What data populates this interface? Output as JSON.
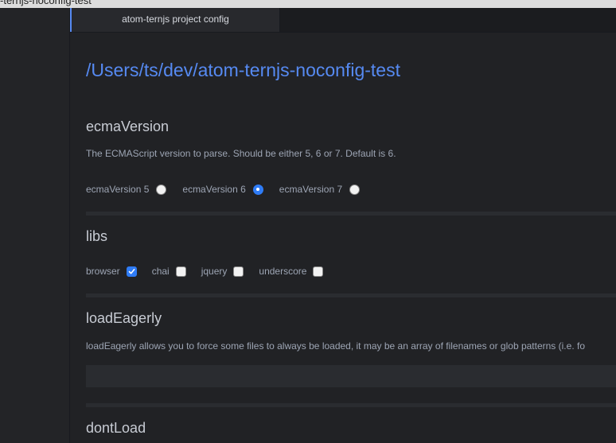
{
  "window": {
    "title": "-ternjs-noconfig-test"
  },
  "tab": {
    "label": "atom-ternjs project config"
  },
  "page": {
    "title": "/Users/ts/dev/atom-ternjs-noconfig-test"
  },
  "ecmaVersion": {
    "title": "ecmaVersion",
    "description": "The ECMAScript version to parse. Should be either 5, 6 or 7. Default is 6.",
    "options": [
      {
        "label": "ecmaVersion 5",
        "checked": false
      },
      {
        "label": "ecmaVersion 6",
        "checked": true
      },
      {
        "label": "ecmaVersion 7",
        "checked": false
      }
    ]
  },
  "libs": {
    "title": "libs",
    "options": [
      {
        "label": "browser",
        "checked": true
      },
      {
        "label": "chai",
        "checked": false
      },
      {
        "label": "jquery",
        "checked": false
      },
      {
        "label": "underscore",
        "checked": false
      }
    ]
  },
  "loadEagerly": {
    "title": "loadEagerly",
    "description": "loadEagerly allows you to force some files to always be loaded, it may be an array of filenames or glob patterns (i.e. fo",
    "value": ""
  },
  "dontLoad": {
    "title": "dontLoad"
  },
  "colors": {
    "accent": "#568af2",
    "control_checked": "#2f7cf6",
    "background": "#212225"
  }
}
